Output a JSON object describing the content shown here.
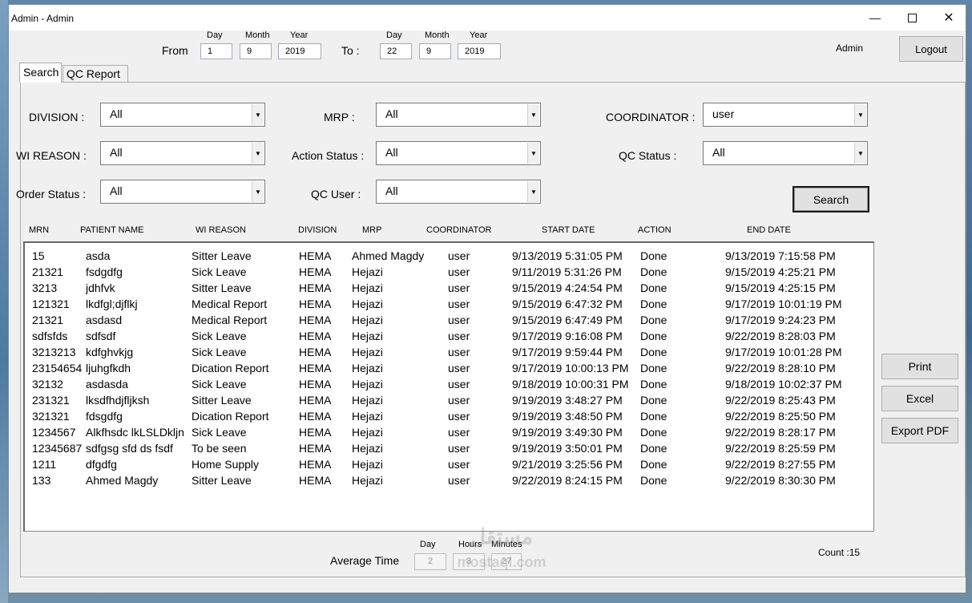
{
  "window": {
    "title": "Admin -  Admin"
  },
  "titlebar": {
    "minimize_icon": "minimize-icon",
    "maximize_icon": "maximize-icon",
    "close_icon": "close-icon"
  },
  "date_filter": {
    "from_label": "From",
    "to_label": "To :",
    "day_label": "Day",
    "month_label": "Month",
    "year_label": "Year",
    "from": {
      "day": "1",
      "month": "9",
      "year": "2019"
    },
    "to": {
      "day": "22",
      "month": "9",
      "year": "2019"
    }
  },
  "user_label": "Admin",
  "logout_label": "Logout",
  "tabs": [
    "Search",
    "QC Report"
  ],
  "filters": {
    "division": {
      "label": "DIVISION :",
      "value": "All"
    },
    "mrp": {
      "label": "MRP :",
      "value": "All"
    },
    "coordinator": {
      "label": "COORDINATOR :",
      "value": "user"
    },
    "wi_reason": {
      "label": "WI REASON :",
      "value": "All"
    },
    "action_status": {
      "label": "Action Status :",
      "value": "All"
    },
    "qc_status": {
      "label": "QC Status :",
      "value": "All"
    },
    "order_status": {
      "label": "Order Status :",
      "value": "All"
    },
    "qc_user": {
      "label": "QC User :",
      "value": "All"
    }
  },
  "search_label": "Search",
  "columns": [
    "MRN",
    "PATIENT NAME",
    "WI REASON",
    "DIVISION",
    "MRP",
    "COORDINATOR",
    "START DATE",
    "ACTION",
    "END DATE"
  ],
  "rows": [
    [
      "15",
      "asda",
      "Sitter Leave",
      "HEMA",
      "Ahmed Magdy",
      "user",
      "9/13/2019 5:31:05 PM",
      "Done",
      "9/13/2019 7:15:58 PM"
    ],
    [
      "21321",
      "fsdgdfg",
      "Sick Leave",
      "HEMA",
      "Hejazi",
      "user",
      "9/11/2019 5:31:26 PM",
      "Done",
      "9/15/2019 4:25:21 PM"
    ],
    [
      "3213",
      "jdhfvk",
      "Sitter Leave",
      "HEMA",
      "Hejazi",
      "user",
      "9/15/2019 4:24:54 PM",
      "Done",
      "9/15/2019 4:25:15 PM"
    ],
    [
      "121321",
      "lkdfgl;djflkj",
      "Medical Report",
      "HEMA",
      "Hejazi",
      "user",
      "9/15/2019 6:47:32 PM",
      "Done",
      "9/17/2019 10:01:19 PM"
    ],
    [
      "21321",
      "asdasd",
      "Medical Report",
      "HEMA",
      "Hejazi",
      "user",
      "9/15/2019 6:47:49 PM",
      "Done",
      "9/17/2019 9:24:23 PM"
    ],
    [
      "sdfsfds",
      "sdfsdf",
      "Sick Leave",
      "HEMA",
      "Hejazi",
      "user",
      "9/17/2019 9:16:08 PM",
      "Done",
      "9/22/2019 8:28:03 PM"
    ],
    [
      "3213213",
      "kdfghvkjg",
      "Sick Leave",
      "HEMA",
      "Hejazi",
      "user",
      "9/17/2019 9:59:44 PM",
      "Done",
      "9/17/2019 10:01:28 PM"
    ],
    [
      "23154654",
      "ljuhgfkdh",
      "Dication Report",
      "HEMA",
      "Hejazi",
      "user",
      "9/17/2019 10:00:13 PM",
      "Done",
      "9/22/2019 8:28:10 PM"
    ],
    [
      "32132",
      "asdasda",
      "Sick Leave",
      "HEMA",
      "Hejazi",
      "user",
      "9/18/2019 10:00:31 PM",
      "Done",
      "9/18/2019 10:02:37 PM"
    ],
    [
      "231321",
      "lksdfhdjfljksh",
      "Sitter Leave",
      "HEMA",
      "Hejazi",
      "user",
      "9/19/2019 3:48:27 PM",
      "Done",
      "9/22/2019 8:25:43 PM"
    ],
    [
      "321321",
      "fdsgdfg",
      "Dication Report",
      "HEMA",
      "Hejazi",
      "user",
      "9/19/2019 3:48:50 PM",
      "Done",
      "9/22/2019 8:25:50 PM"
    ],
    [
      "1234567",
      "Alkfhsdc lkLSLDkljn",
      "Sick Leave",
      "HEMA",
      "Hejazi",
      "user",
      "9/19/2019 3:49:30 PM",
      "Done",
      "9/22/2019 8:28:17 PM"
    ],
    [
      "12345687",
      "sdfgsg sfd ds fsdf",
      "To be seen",
      "HEMA",
      "Hejazi",
      "user",
      "9/19/2019 3:50:01 PM",
      "Done",
      "9/22/2019 8:25:59 PM"
    ],
    [
      "1211",
      "dfgdfg",
      "Home Supply",
      "HEMA",
      "Hejazi",
      "user",
      "9/21/2019 3:25:56 PM",
      "Done",
      "9/22/2019 8:27:55 PM"
    ],
    [
      "133",
      "Ahmed Magdy",
      "Sitter Leave",
      "HEMA",
      "Hejazi",
      "user",
      "9/22/2019 8:24:15 PM",
      "Done",
      "9/22/2019 8:30:30 PM"
    ]
  ],
  "actions": {
    "print": "Print",
    "excel": "Excel",
    "export_pdf": "Export PDF"
  },
  "average": {
    "label": "Average Time",
    "day_label": "Day",
    "hours_label": "Hours",
    "minutes_label": "Minutes",
    "day": "2",
    "hours": "3",
    "minutes": "27"
  },
  "count_text": "Count :15",
  "watermark": {
    "line1": "مستقل",
    "line2": "mostaql.com"
  }
}
